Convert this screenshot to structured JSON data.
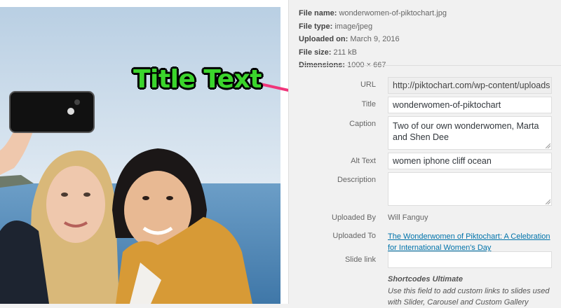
{
  "overlay": {
    "label": "Title Text",
    "label_color": "#3bd52c",
    "arrow_color": "#f0357a"
  },
  "file_info": {
    "name_label": "File name:",
    "name": "wonderwomen-of-piktochart.jpg",
    "type_label": "File type:",
    "type": "image/jpeg",
    "uploaded_label": "Uploaded on:",
    "uploaded": "March 9, 2016",
    "size_label": "File size:",
    "size": "211 kB",
    "dimensions_label": "Dimensions:",
    "dimensions": "1000 × 667"
  },
  "fields": {
    "url_label": "URL",
    "url_value": "http://piktochart.com/wp-content/uploads",
    "title_label": "Title",
    "title_value": "wonderwomen-of-piktochart",
    "caption_label": "Caption",
    "caption_value": "Two of our own wonderwomen, Marta and Shen Dee",
    "alt_label": "Alt Text",
    "alt_value": "women iphone cliff ocean",
    "description_label": "Description",
    "description_value": "",
    "uploaded_by_label": "Uploaded By",
    "uploaded_by_value": "Will Fanguy",
    "uploaded_to_label": "Uploaded To",
    "uploaded_to_value": "The Wonderwomen of Piktochart: A Celebration for International Women's Day",
    "slide_link_label": "Slide link",
    "slide_link_value": ""
  },
  "shortcodes": {
    "title": "Shortcodes Ultimate",
    "description": "Use this field to add custom links to slides used with Slider, Carousel and Custom Gallery"
  }
}
